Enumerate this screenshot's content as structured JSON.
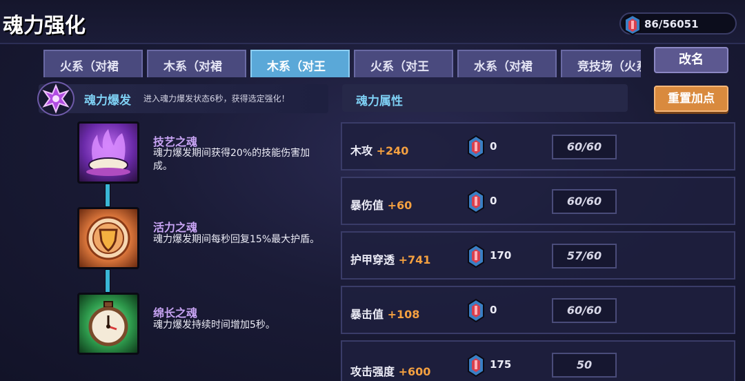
{
  "header": {
    "title": "魂力强化",
    "currency_value": "86/56051"
  },
  "tabs": [
    {
      "label": "火系（对裙",
      "active": false
    },
    {
      "label": "木系（对裙",
      "active": false
    },
    {
      "label": "木系（对王",
      "active": true
    },
    {
      "label": "火系（对王",
      "active": false
    },
    {
      "label": "水系（对裙",
      "active": false
    },
    {
      "label": "竞技场（火系",
      "active": false
    }
  ],
  "buttons": {
    "rename": "改名",
    "reset": "重置加点"
  },
  "burst": {
    "name": "魂力爆发",
    "description": "进入魂力爆发状态6秒，获得选定强化！"
  },
  "skills": [
    {
      "name": "技艺之魂",
      "description": "魂力爆发期间获得20%的技能伤害加成。",
      "icon": "purple-flame-icon",
      "color": "#8a3cd8"
    },
    {
      "name": "活力之魂",
      "description": "魂力爆发期间每秒回复15%最大护盾。",
      "icon": "shield-icon",
      "color": "#e08a3c"
    },
    {
      "name": "绵长之魂",
      "description": "魂力爆发持续时间增加5秒。",
      "icon": "clock-icon",
      "color": "#3ab45c"
    }
  ],
  "attributes_panel": {
    "title": "魂力属性"
  },
  "attributes": [
    {
      "name": "木攻",
      "bonus": "+240",
      "cost": "0",
      "level": "60/60"
    },
    {
      "name": "暴伤值",
      "bonus": "+60",
      "cost": "0",
      "level": "60/60"
    },
    {
      "name": "护甲穿透",
      "bonus": "+741",
      "cost": "170",
      "level": "57/60"
    },
    {
      "name": "暴击值",
      "bonus": "+108",
      "cost": "0",
      "level": "60/60"
    },
    {
      "name": "攻击强度",
      "bonus": "+600",
      "cost": "175",
      "level": "50"
    }
  ],
  "colors": {
    "accent_cyan": "#7ed0f4",
    "bonus_orange": "#f4a040",
    "active_tab": "#5aa8d8",
    "reset_button": "#d98a3e"
  }
}
